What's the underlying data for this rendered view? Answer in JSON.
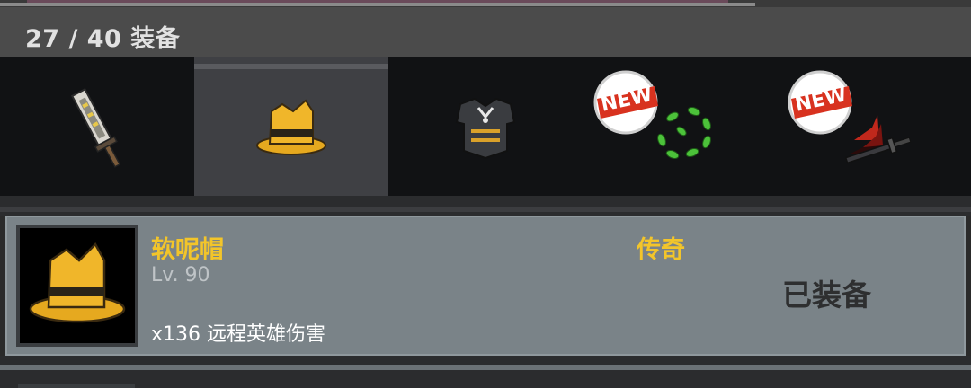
{
  "header": {
    "count_text": "27 / 40 装备"
  },
  "tabs": [
    {
      "icon": "sword-icon",
      "active": false,
      "badge": ""
    },
    {
      "icon": "fedora-hat-icon",
      "active": true,
      "badge": ""
    },
    {
      "icon": "armor-chestplate-icon",
      "active": false,
      "badge": ""
    },
    {
      "icon": "leaf-wreath-icon",
      "active": false,
      "badge": "NEW"
    },
    {
      "icon": "dark-blade-icon",
      "active": false,
      "badge": "NEW"
    }
  ],
  "item": {
    "icon": "fedora-hat-icon",
    "name": "软呢帽",
    "level": "Lv. 90",
    "stat": "x136 远程英雄伤害",
    "rarity": "传奇",
    "status": "已装备"
  },
  "colors": {
    "accent_gold": "#f3c52a",
    "badge_red": "#d8321f"
  }
}
